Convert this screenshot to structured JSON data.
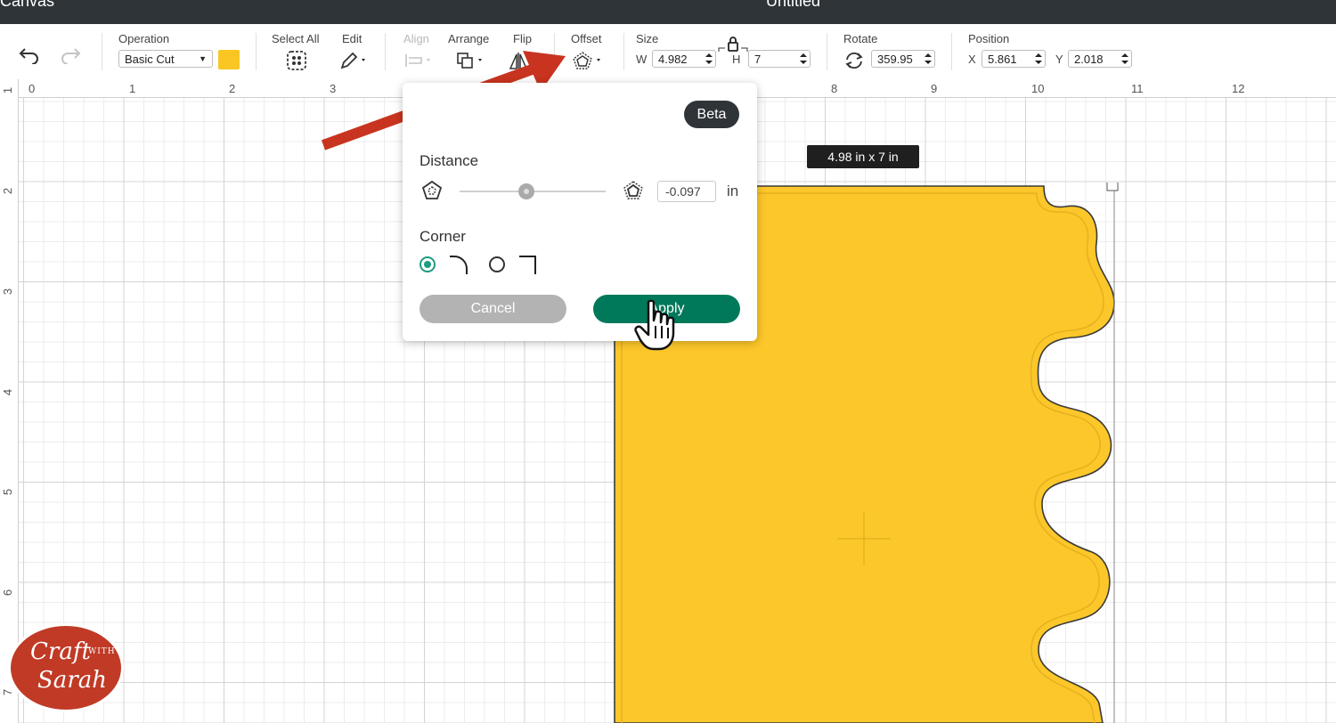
{
  "titlebar": {
    "left": "Canvas",
    "center": "Untitled"
  },
  "toolbar": {
    "operation_label": "Operation",
    "operation_value": "Basic Cut",
    "operation_color": "#f9c623",
    "select_all_label": "Select All",
    "edit_label": "Edit",
    "align_label": "Align",
    "arrange_label": "Arrange",
    "flip_label": "Flip",
    "offset_label": "Offset",
    "size_label": "Size",
    "width_label": "W",
    "width_value": "4.982",
    "height_label": "H",
    "height_value": "7",
    "rotate_label": "Rotate",
    "rotate_value": "359.95",
    "position_label": "Position",
    "x_label": "X",
    "x_value": "5.861",
    "y_label": "Y",
    "y_value": "2.018"
  },
  "ruler": {
    "top": [
      "0",
      "1",
      "2",
      "3",
      "8",
      "9",
      "10",
      "11",
      "12"
    ],
    "left": [
      "1",
      "2",
      "3",
      "4",
      "5",
      "6",
      "7"
    ]
  },
  "canvas": {
    "dimension_tooltip": "4.98  in x 7  in",
    "shape_color": "#fcc72a"
  },
  "offset_popup": {
    "badge": "Beta",
    "distance_label": "Distance",
    "distance_value": "-0.097",
    "distance_unit": "in",
    "distance_slider_fraction": 0.46,
    "corner_label": "Corner",
    "corner_selected": "rounded",
    "cancel_label": "Cancel",
    "apply_label": "Apply"
  },
  "logo": {
    "line1": "Craft",
    "line2": "WITH",
    "line3": "Sarah"
  },
  "colors": {
    "accent_green": "#00795a",
    "arrow_red": "#c8341f",
    "dark": "#2f3439"
  }
}
